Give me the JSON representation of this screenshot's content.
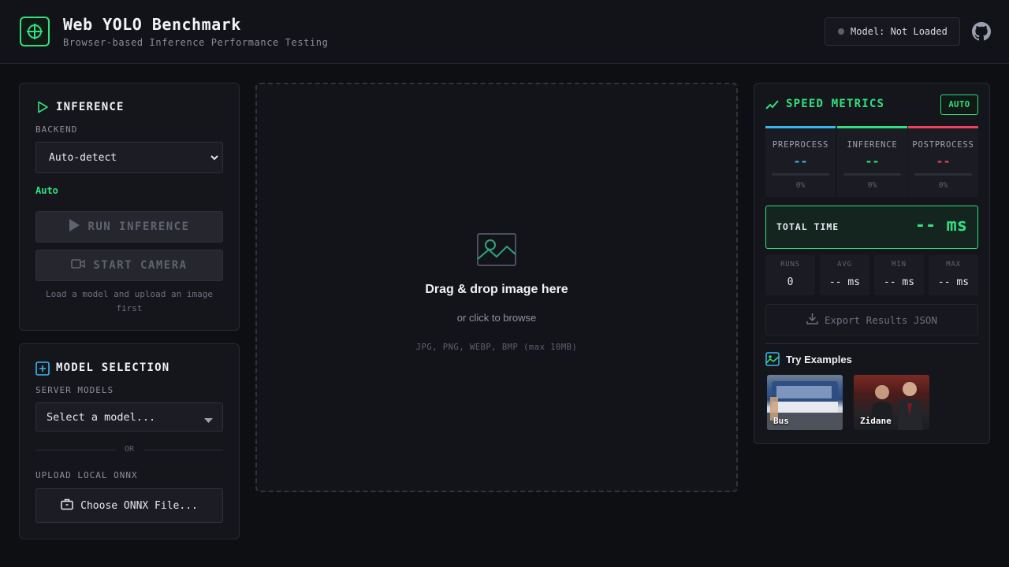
{
  "header": {
    "title": "Web YOLO Benchmark",
    "subtitle": "Browser-based Inference Performance Testing",
    "model_status": "Model: Not Loaded"
  },
  "inference": {
    "title": "INFERENCE",
    "backend_label": "BACKEND",
    "backend_value": "Auto-detect",
    "backend_status": "Auto",
    "run_button": "RUN INFERENCE",
    "camera_button": "START CAMERA",
    "hint": "Load a model and upload an image first"
  },
  "model_selection": {
    "title": "MODEL SELECTION",
    "server_label": "SERVER MODELS",
    "server_placeholder": "Select a model...",
    "or_text": "OR",
    "upload_label": "UPLOAD LOCAL ONNX",
    "upload_button": "Choose ONNX File..."
  },
  "dropzone": {
    "title": "Drag & drop image here",
    "subtitle": "or click to browse",
    "formats": "JPG, PNG, WEBP, BMP (max 10MB)"
  },
  "metrics": {
    "title": "SPEED METRICS",
    "badge": "AUTO",
    "stages": [
      {
        "name": "PREPROCESS",
        "value": "--",
        "pct": "0%",
        "color": "#38b6f0"
      },
      {
        "name": "INFERENCE",
        "value": "--",
        "pct": "0%",
        "color": "#2ee07f"
      },
      {
        "name": "POSTPROCESS",
        "value": "--",
        "pct": "0%",
        "color": "#f0405a"
      }
    ],
    "total_label": "TOTAL TIME",
    "total_value": "-- ms",
    "stats": [
      {
        "name": "RUNS",
        "value": "0"
      },
      {
        "name": "AVG",
        "value": "-- ms"
      },
      {
        "name": "MIN",
        "value": "-- ms"
      },
      {
        "name": "MAX",
        "value": "-- ms"
      }
    ],
    "export_button": "Export Results JSON",
    "examples_title": "Try Examples",
    "examples": [
      {
        "label": "Bus"
      },
      {
        "label": "Zidane"
      }
    ]
  },
  "colors": {
    "accent_green": "#2ee07f",
    "accent_blue": "#38b6f0",
    "accent_red": "#f0405a",
    "background": "#0e0f13"
  }
}
